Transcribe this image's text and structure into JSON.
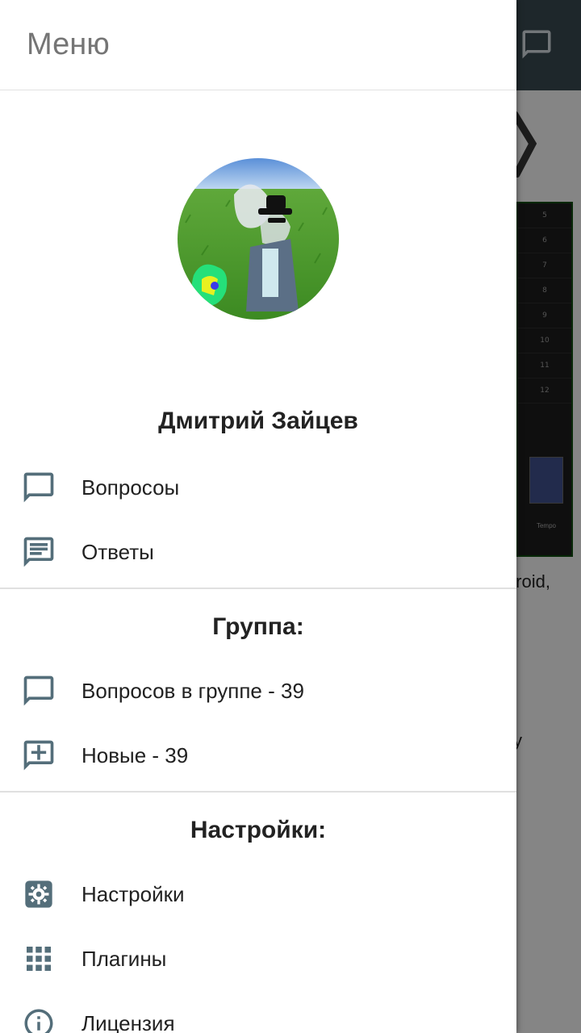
{
  "drawer": {
    "title": "Меню",
    "user_name": "Дмитрий Зайцев",
    "items": [
      {
        "label": "Вопросоы",
        "icon": "chat-bubble-icon"
      },
      {
        "label": "Ответы",
        "icon": "message-text-icon"
      }
    ],
    "group": {
      "title": "Группа:",
      "items": [
        {
          "label": "Вопросов в группе - 39",
          "icon": "chat-bubble-icon"
        },
        {
          "label": "Новые - 39",
          "icon": "add-comment-icon"
        }
      ]
    },
    "settings": {
      "title": "Настройки:",
      "items": [
        {
          "label": "Настройки",
          "icon": "gear-icon"
        },
        {
          "label": "Плагины",
          "icon": "grid-icon"
        },
        {
          "label": "Лицензия",
          "icon": "info-icon"
        }
      ]
    }
  },
  "background": {
    "text_line_1": "Android,",
    "text_line_2": "y",
    "screen_rows": [
      "5",
      "6",
      "7",
      "8",
      "9",
      "10",
      "11",
      "12"
    ],
    "tempo_label": "Tempo"
  },
  "colors": {
    "toolbar": "#37474f",
    "icon": "#546e7a",
    "title": "#757575"
  }
}
